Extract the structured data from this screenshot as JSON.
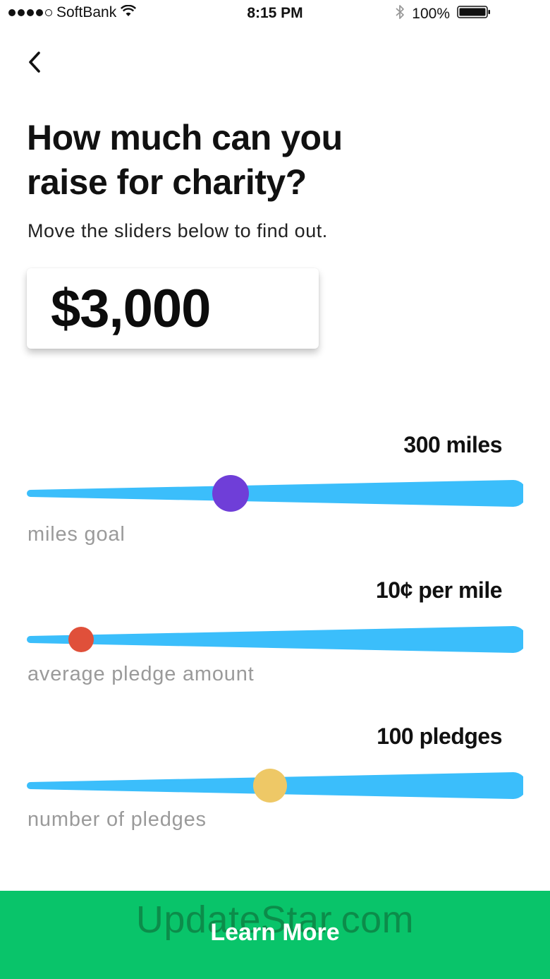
{
  "status_bar": {
    "carrier": "SoftBank",
    "time": "8:15 PM",
    "battery_percent": "100%",
    "signal_icon": "signal-dots-icon",
    "wifi_icon": "wifi-icon",
    "bluetooth_icon": "bluetooth-icon",
    "battery_icon": "battery-icon"
  },
  "nav": {
    "back_icon": "chevron-left-icon"
  },
  "header": {
    "title": "How much can you raise for charity?",
    "subtitle": "Move the sliders below to find out."
  },
  "total": {
    "amount": "$3,000"
  },
  "sliders": [
    {
      "value_text": "300 miles",
      "label": "miles goal",
      "position": 0.41,
      "thumb_color": "#6f3ed8"
    },
    {
      "value_text": "10¢ per mile",
      "label": "average pledge amount",
      "position": 0.11,
      "thumb_color": "#e0503a"
    },
    {
      "value_text": "100 pledges",
      "label": "number of pledges",
      "position": 0.49,
      "thumb_color": "#eec866"
    }
  ],
  "colors": {
    "track": "#3bbefb",
    "button": "#09c46a",
    "label": "#9a9a9a"
  },
  "cta": {
    "label": "Learn More"
  },
  "watermark": "UpdateStar.com"
}
